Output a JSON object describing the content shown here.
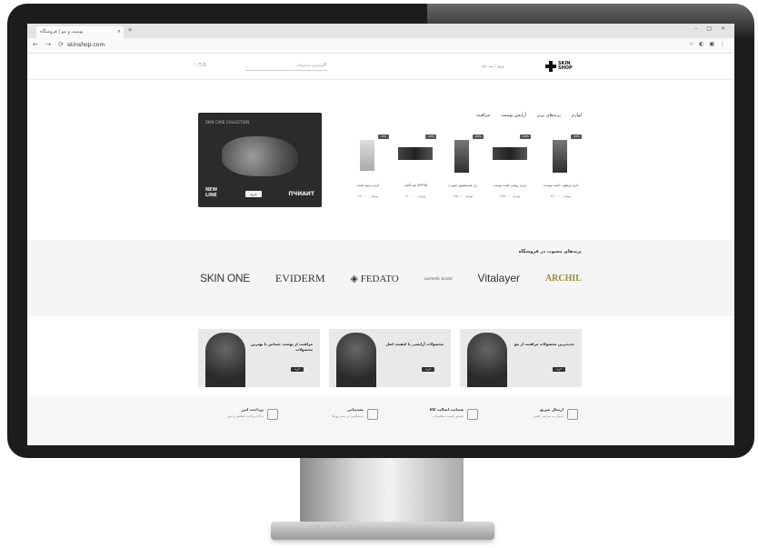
{
  "browser": {
    "tab_title": "پوست و مو | فروشگاه",
    "tab_close": "×",
    "new_tab": "+",
    "window_controls": "– □ ×",
    "nav": "← → ⟳",
    "url": "skinshop.com",
    "extensions": "☆ ◐ ▣ ⋮"
  },
  "header": {
    "logo_text": "SKIN SHOP",
    "link": "ورود / ثبت نام",
    "search_placeholder": "جستجوی محصولات",
    "tools": "♡ ⛉ 0"
  },
  "categories": [
    "مراقبت",
    "آرایش پوست",
    "برندهای برتر",
    "لوازم"
  ],
  "feature": {
    "top_text": "SKIN CARE COLLECTION",
    "left_text": "NEW\nLINE",
    "button": "خرید",
    "brand": "ПЧИАИТ"
  },
  "products": [
    {
      "badge": "-15%",
      "name": "کرم مرطوب کننده پوست",
      "price": "۳۲۰,۰۰۰ تومان"
    },
    {
      "badge": "-10%",
      "name": "سرم روشن کننده پوست",
      "price": "۲۸۵,۰۰۰ تومان"
    },
    {
      "badge": "-20%",
      "name": "ژل شستشوی صورت",
      "price": "۱۹۵,۰۰۰ تومان"
    },
    {
      "badge": "-15%",
      "name": "ضد آفتاب SPF50",
      "price": "۴۱۰,۰۰۰ تومان"
    },
    {
      "badge": "-5%",
      "name": "کرم ترمیم کننده",
      "price": "۲۴۰,۰۰۰ تومان"
    }
  ],
  "brands": {
    "title": "برندهای محبوب در فروشگاه",
    "items": [
      "SKIN ONE",
      "EVIDERM",
      "FEDATO",
      "cosmetic brand",
      "Vitalayer",
      "ARCHIL"
    ]
  },
  "promos": [
    {
      "title": "مراقبت از پوست حساس با بهترین محصولات",
      "button": "خرید"
    },
    {
      "title": "محصولات آرایشی با کیفیت اصل",
      "button": "خرید"
    },
    {
      "title": "جدیدترین محصولات مراقبت از مو",
      "button": "خرید"
    }
  ],
  "services": [
    {
      "title": "ارسال سریع",
      "sub": "ارسال به سراسر کشور"
    },
    {
      "title": "ضمانت اصالت کالا",
      "sub": "تضمین کیفیت محصولات"
    },
    {
      "title": "پشتیبانی",
      "sub": "پاسخگویی در تمام روزها"
    },
    {
      "title": "پرداخت امن",
      "sub": "درگاه پرداخت مطمئن و امن"
    }
  ]
}
